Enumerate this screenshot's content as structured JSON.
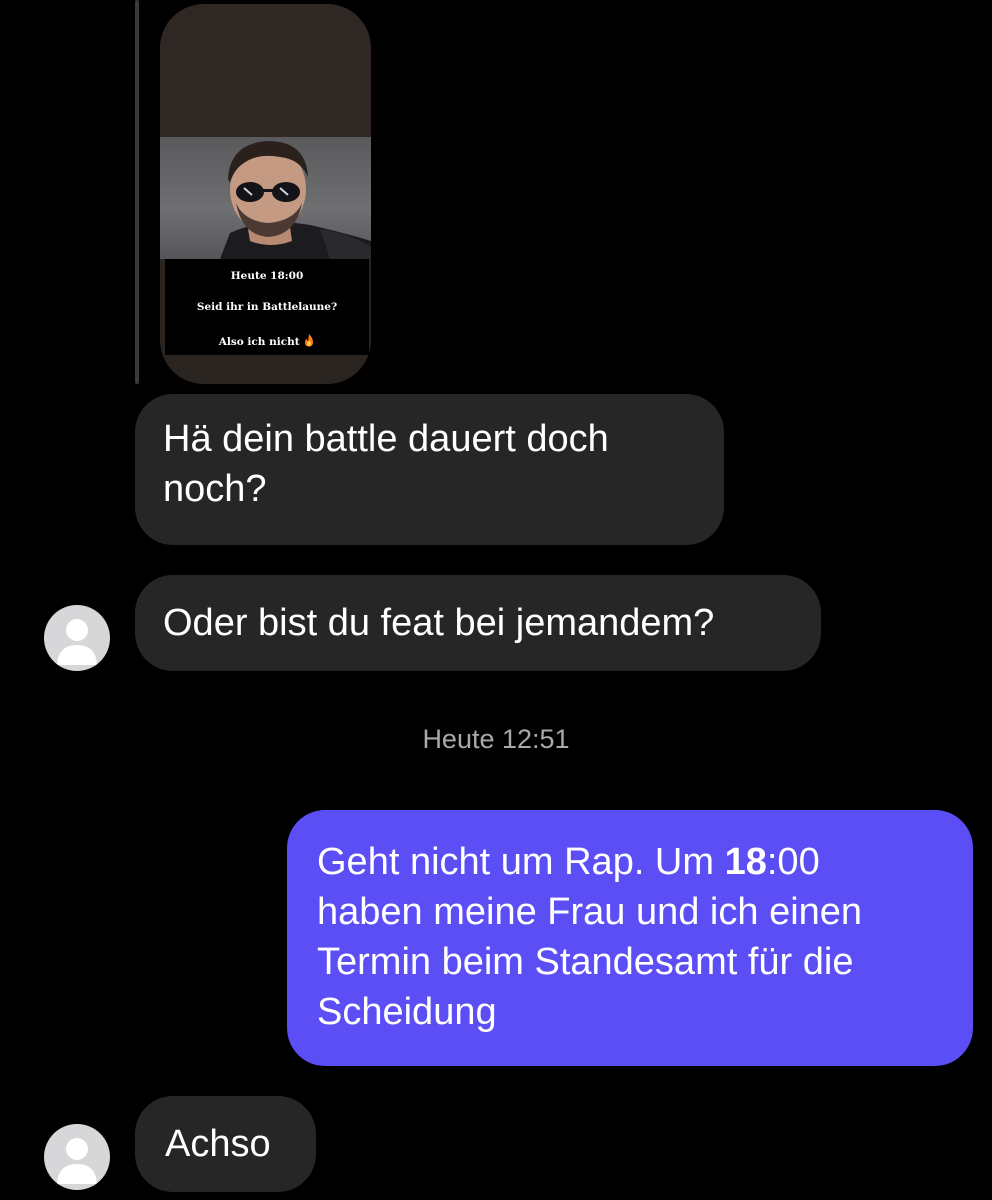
{
  "story_reply": {
    "overlay_lines": [
      "Heute 18:00",
      "Seid ihr in Battlelaune?",
      "Also ich nicht"
    ],
    "overlay_emoji": "fire-emoji"
  },
  "messages": [
    {
      "direction": "incoming",
      "lines": [
        "Hä dein battle dauert doch",
        "noch?"
      ]
    },
    {
      "direction": "incoming",
      "lines": [
        "Oder bist du feat bei jemandem?"
      ]
    },
    {
      "direction": "outgoing",
      "line1_before": "Geht nicht um Rap. Um ",
      "line1_bold": "18",
      "line1_after": ":00",
      "lines_rest": [
        "haben meine Frau und ich einen",
        "Termin beim Standesamt für die",
        "Scheidung"
      ]
    },
    {
      "direction": "incoming",
      "lines": [
        "Achso"
      ]
    }
  ],
  "timestamp": "Heute 12:51",
  "colors": {
    "background": "#000000",
    "incoming_bubble": "#262626",
    "outgoing_bubble": "#5b4ef5",
    "timestamp_text": "#a8a8a8"
  },
  "icons": {
    "avatar": "default-avatar-icon"
  }
}
